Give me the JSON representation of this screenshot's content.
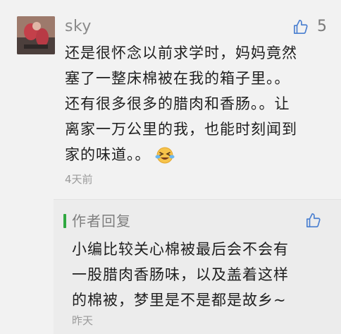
{
  "comment": {
    "username": "sky",
    "like_count": "5",
    "text_lines": [
      "还是很怀念以前求学时，妈妈竟然",
      "塞了一整床棉被在我的箱子里。。",
      "还有很多很多的腊肉和香肠。。让",
      "离家一万公里的我，也能时刻闻到",
      "家的味道。。"
    ],
    "emoji_icon": "tears-of-joy-emoji-icon",
    "timestamp": "4天前"
  },
  "reply": {
    "author_label": "作者回复",
    "text_lines": [
      "小编比较关心棉被最后会不会有",
      "一股腊肉香肠味，以及盖着这样",
      "的棉被，梦里是不是都是故乡~"
    ],
    "timestamp": "昨天"
  },
  "colors": {
    "background": "#f2f2f2",
    "reply_background": "#ececec",
    "accent_blue": "#4a7fd0",
    "author_green": "#2fa840",
    "muted_text": "#8a8a8a"
  }
}
